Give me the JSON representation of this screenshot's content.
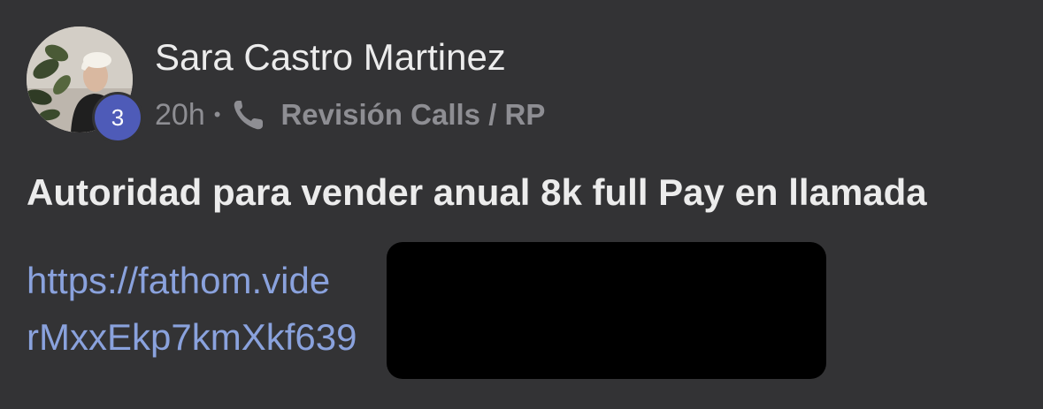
{
  "post": {
    "author": {
      "name": "Sara Castro Martinez",
      "level_badge": "3"
    },
    "meta": {
      "timestamp": "20h",
      "separator": "•",
      "channel_icon": "phone-icon",
      "channel": "Revisión Calls / RP"
    },
    "title": "Autoridad para vender anual 8k full Pay en llamada",
    "link": {
      "line1": "https://fathom.vide",
      "line2": "rMxxEkp7kmXkf639"
    }
  },
  "colors": {
    "background": "#333335",
    "badge": "#4e5bb8",
    "link": "#8aa2dd",
    "meta_text": "#8e8e93"
  }
}
